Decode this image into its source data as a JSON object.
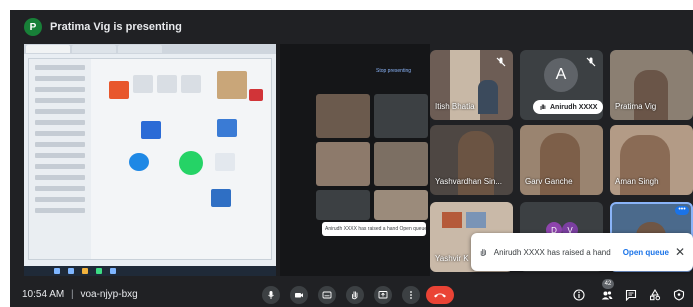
{
  "presenter": {
    "initial": "P",
    "banner": "Pratima Vig is presenting"
  },
  "shared_screen": {
    "mini_presenting_label": "Stop presenting",
    "mini_toast": "Anirudh XXXX has raised a hand   Open queue"
  },
  "participants": [
    {
      "name": "Itish Bhatia",
      "muted": true,
      "kind": "video"
    },
    {
      "name": "Anirudh XXXX",
      "muted": true,
      "kind": "avatar",
      "initial": "A",
      "hand_raised": true
    },
    {
      "name": "Pratima Vig",
      "muted": false,
      "kind": "video"
    },
    {
      "name": "Yashvardhan Sin...",
      "muted": false,
      "kind": "video"
    },
    {
      "name": "Garv Ganche",
      "muted": false,
      "kind": "video"
    },
    {
      "name": "Aman Singh",
      "muted": false,
      "kind": "video"
    },
    {
      "name": "Yashvir K",
      "muted": false,
      "kind": "video"
    },
    {
      "name": "",
      "muted": false,
      "kind": "initials",
      "initials": [
        "D",
        "V"
      ]
    },
    {
      "name": "",
      "muted": false,
      "kind": "video",
      "more_options": true
    }
  ],
  "toast": {
    "message": "Anirudh XXXX has raised a hand",
    "action": "Open queue",
    "close": "✕"
  },
  "bottom": {
    "time": "10:54 AM",
    "separator": "|",
    "meeting_code": "voa-njyp-bxg",
    "people_count": "42"
  },
  "colors": {
    "background": "#202124",
    "tile": "#3c4043",
    "end_call": "#ea4335",
    "link": "#1a73e8",
    "presenter_avatar": "#188038"
  },
  "icons": [
    "mic-icon",
    "camera-icon",
    "captions-icon",
    "raise-hand-icon",
    "present-icon",
    "more-options-icon",
    "end-call-icon",
    "info-icon",
    "people-icon",
    "chat-icon",
    "activities-icon",
    "host-controls-icon"
  ]
}
